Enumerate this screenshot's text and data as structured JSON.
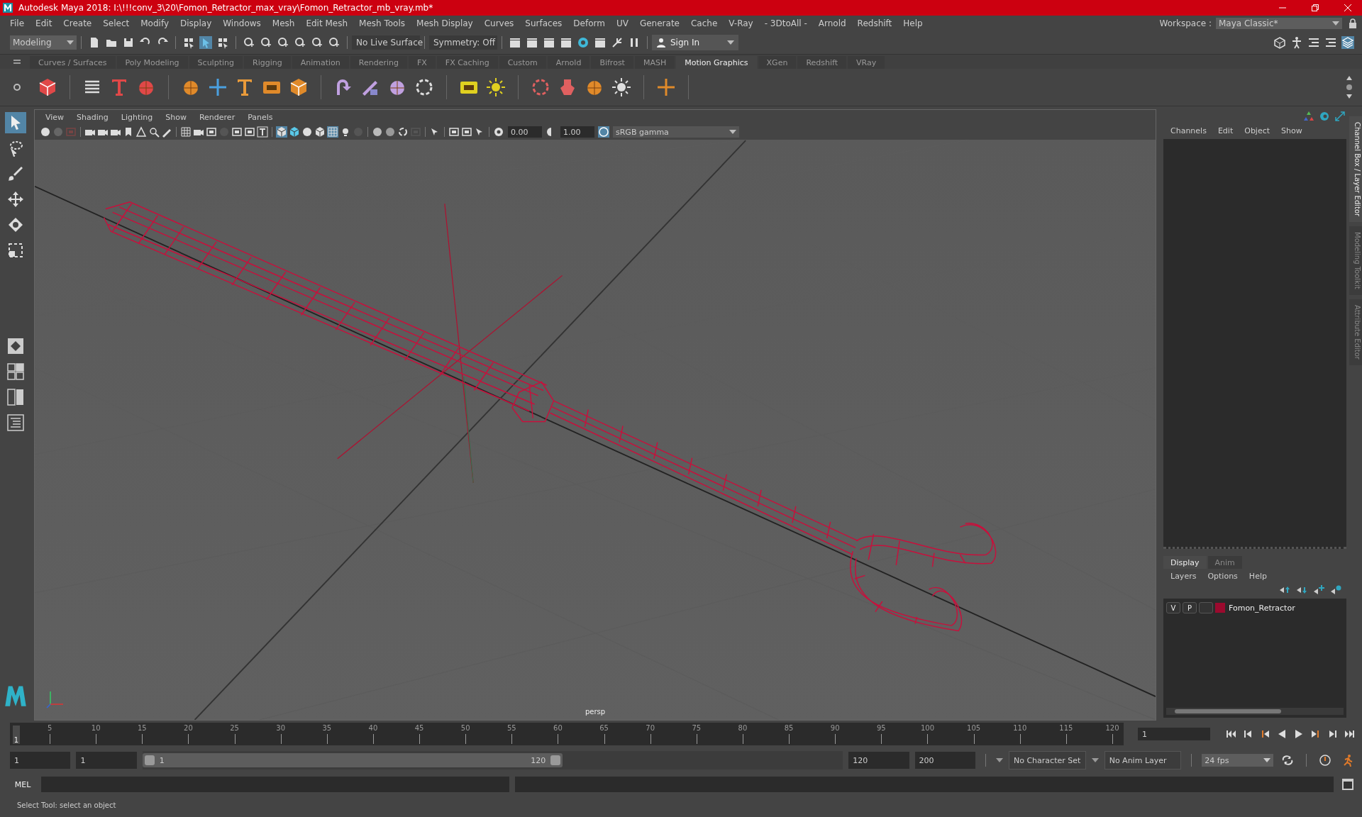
{
  "window": {
    "title": "Autodesk Maya 2018: I:\\!!!conv_3\\20\\Fomon_Retractor_max_vray\\Fomon_Retractor_mb_vray.mb*"
  },
  "menu_bar": [
    "File",
    "Edit",
    "Create",
    "Select",
    "Modify",
    "Display",
    "Windows",
    "Mesh",
    "Edit Mesh",
    "Mesh Tools",
    "Mesh Display",
    "Curves",
    "Surfaces",
    "Deform",
    "UV",
    "Generate",
    "Cache",
    "V-Ray",
    "- 3DtoAll -",
    "Arnold",
    "Redshift",
    "Help"
  ],
  "workspace": {
    "label": "Workspace :",
    "value": "Maya Classic*"
  },
  "status_line": {
    "menu_set": "Modeling",
    "live_surface": "No Live Surface",
    "symmetry": "Symmetry: Off",
    "sign_in": "Sign In"
  },
  "shelf_tabs": [
    {
      "label": "Curves / Surfaces",
      "selected": false
    },
    {
      "label": "Poly Modeling",
      "selected": false
    },
    {
      "label": "Sculpting",
      "selected": false
    },
    {
      "label": "Rigging",
      "selected": false
    },
    {
      "label": "Animation",
      "selected": false
    },
    {
      "label": "Rendering",
      "selected": false
    },
    {
      "label": "FX",
      "selected": false
    },
    {
      "label": "FX Caching",
      "selected": false
    },
    {
      "label": "Custom",
      "selected": false
    },
    {
      "label": "Arnold",
      "selected": false
    },
    {
      "label": "Bifrost",
      "selected": false
    },
    {
      "label": "MASH",
      "selected": false
    },
    {
      "label": "Motion Graphics",
      "selected": true
    },
    {
      "label": "XGen",
      "selected": false
    },
    {
      "label": "Redshift",
      "selected": false
    },
    {
      "label": "VRay",
      "selected": false
    }
  ],
  "toolbox": {
    "tools": [
      {
        "kind": "select",
        "selected": true
      },
      {
        "kind": "lasso",
        "selected": false
      },
      {
        "kind": "paint",
        "selected": false
      },
      {
        "kind": "move",
        "selected": false
      },
      {
        "kind": "rotate",
        "selected": false
      },
      {
        "kind": "scale",
        "selected": false
      }
    ]
  },
  "viewport": {
    "menus": [
      "View",
      "Shading",
      "Lighting",
      "Show",
      "Renderer",
      "Panels"
    ],
    "exposure": "0.00",
    "gamma": "1.00",
    "color_space": "sRGB gamma",
    "camera": "persp"
  },
  "channel_box": {
    "menus": [
      "Channels",
      "Edit",
      "Object",
      "Show"
    ]
  },
  "side_tabs": [
    {
      "label": "Channel Box / Layer Editor",
      "selected": true
    },
    {
      "label": "Modeling Toolkit",
      "selected": false
    },
    {
      "label": "Attribute Editor",
      "selected": false
    }
  ],
  "layer_editor": {
    "tabs": [
      {
        "label": "Display",
        "selected": true
      },
      {
        "label": "Anim",
        "selected": false
      }
    ],
    "menus": [
      "Layers",
      "Options",
      "Help"
    ],
    "layers": [
      {
        "visible": "V",
        "playback": "P",
        "color": "#9b0a2e",
        "name": "Fomon_Retractor"
      }
    ]
  },
  "timeline": {
    "ticks": [
      "5",
      "10",
      "15",
      "20",
      "25",
      "30",
      "35",
      "40",
      "45",
      "50",
      "55",
      "60",
      "65",
      "70",
      "75",
      "80",
      "85",
      "90",
      "95",
      "100",
      "105",
      "110",
      "115",
      "120"
    ],
    "current_frame": "1",
    "frame_field": "1",
    "level": 0
  },
  "range": {
    "start": "1",
    "playback_start": "1",
    "slider_start": "1",
    "slider_end": "120",
    "level": 0.6,
    "playback_end": "120",
    "end": "200",
    "character_set": "No Character Set",
    "anim_layer": "No Anim Layer",
    "fps": "24 fps"
  },
  "command_line": {
    "label": "MEL"
  },
  "help_line": "Select Tool: select an object"
}
